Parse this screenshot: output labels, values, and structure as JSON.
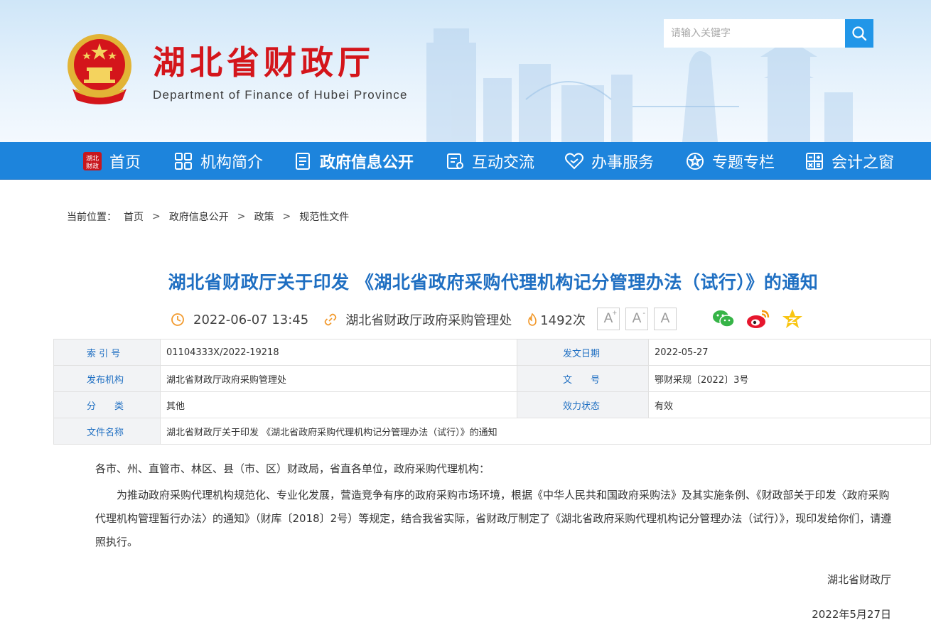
{
  "header": {
    "title": "湖北省财政厅",
    "subtitle": "Department of Finance of Hubei Province",
    "search_placeholder": "请输入关键字",
    "colors": {
      "title_red": "#d4151b",
      "nav_blue": "#1d84dc",
      "search_btn": "#2196e8"
    }
  },
  "nav": {
    "items": [
      {
        "label": "首页",
        "icon": "hubei-finance-logo-icon"
      },
      {
        "label": "机构简介",
        "icon": "grid-icon"
      },
      {
        "label": "政府信息公开",
        "icon": "document-list-icon",
        "active": true
      },
      {
        "label": "互动交流",
        "icon": "chat-form-icon"
      },
      {
        "label": "办事服务",
        "icon": "heart-hand-icon"
      },
      {
        "label": "专题专栏",
        "icon": "star-circle-icon"
      },
      {
        "label": "会计之窗",
        "icon": "calculator-icon"
      }
    ]
  },
  "breadcrumb": {
    "prefix": "当前位置：",
    "items": [
      "首页",
      "政府信息公开",
      "政策",
      "规范性文件"
    ],
    "separator": ">"
  },
  "article": {
    "title": "湖北省财政厅关于印发 《湖北省政府采购代理机构记分管理办法（试行）》的通知",
    "datetime": "2022-06-07 13:45",
    "source": "湖北省财政厅政府采购管理处",
    "views": "1492次",
    "font_buttons": [
      "A",
      "A",
      "A"
    ],
    "font_button_marks": [
      "+",
      "-",
      ""
    ],
    "share": [
      "wechat-icon",
      "weibo-icon",
      "qzone-icon"
    ]
  },
  "info": {
    "index_label": "索 引 号",
    "index_value": "01104333X/2022-19218",
    "issue_date_label": "发文日期",
    "issue_date_value": "2022-05-27",
    "publisher_label": "发布机构",
    "publisher_value": "湖北省财政厅政府采购管理处",
    "doc_no_label": "文　　号",
    "doc_no_value": "鄂财采规〔2022〕3号",
    "category_label": "分　　类",
    "category_value": "其他",
    "status_label": "效力状态",
    "status_value": "有效",
    "filename_label": "文件名称",
    "filename_value": "湖北省财政厅关于印发 《湖北省政府采购代理机构记分管理办法（试行）》的通知"
  },
  "body": {
    "salutation": "各市、州、直管市、林区、县（市、区）财政局，省直各单位，政府采购代理机构：",
    "paragraph1": "为推动政府采购代理机构规范化、专业化发展，营造竞争有序的政府采购市场环境，根据《中华人民共和国政府采购法》及其实施条例、《财政部关于印发〈政府采购代理机构管理暂行办法〉的通知》（财库〔2018〕2号）等规定，结合我省实际，省财政厅制定了《湖北省政府采购代理机构记分管理办法（试行）》，现印发给你们，请遵照执行。",
    "signature": "湖北省财政厅",
    "date": "2022年5月27日"
  }
}
